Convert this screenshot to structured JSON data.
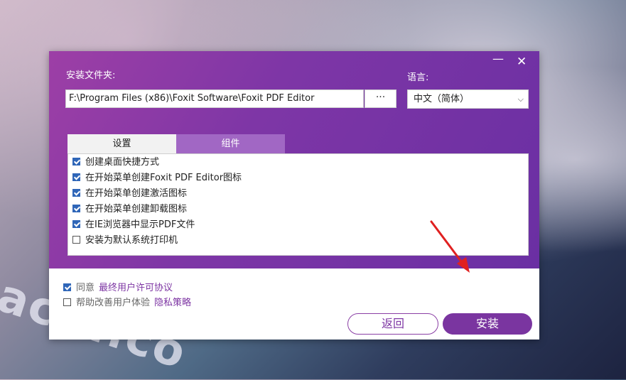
{
  "window": {
    "minimize_symbol": "—",
    "close_symbol": "✕"
  },
  "install_folder": {
    "label": "安装文件夹:",
    "path": "F:\\Program Files (x86)\\Foxit Software\\Foxit PDF Editor",
    "browse_label": "···"
  },
  "language": {
    "label": "语言:",
    "selected": "中文（简体）",
    "arrow": "⌵"
  },
  "tabs": [
    {
      "label": "设置",
      "active": true
    },
    {
      "label": "组件",
      "active": false
    }
  ],
  "options": [
    {
      "label": "创建桌面快捷方式",
      "checked": true
    },
    {
      "label": "在开始菜单创建Foxit PDF Editor图标",
      "checked": true
    },
    {
      "label": "在开始菜单创建激活图标",
      "checked": true
    },
    {
      "label": "在开始菜单创建卸载图标",
      "checked": true
    },
    {
      "label": "在IE浏览器中显示PDF文件",
      "checked": true
    },
    {
      "label": "安装为默认系统打印机",
      "checked": false
    }
  ],
  "agreements": [
    {
      "label": "同意",
      "link": "最终用户许可协议",
      "checked": true
    },
    {
      "label": "帮助改善用户体验",
      "link": "隐私策略",
      "checked": false
    }
  ],
  "buttons": {
    "back": "返回",
    "install": "安装"
  },
  "watermark": "acXf.co",
  "colors": {
    "accent": "#7a35a0",
    "header_gradient_start": "#9d3fa6",
    "header_gradient_end": "#6a2fa3",
    "checkbox": "#2f66b8",
    "arrow": "#e02020"
  }
}
